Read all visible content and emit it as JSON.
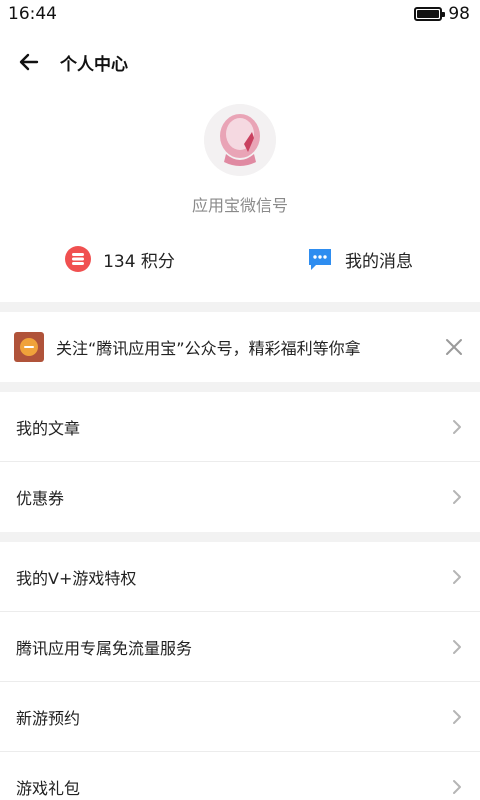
{
  "status_bar": {
    "time": "16:44",
    "battery": "98",
    "battery_level": 0.98
  },
  "header": {
    "title": "个人中心",
    "back_icon": "arrow-left-icon"
  },
  "profile": {
    "name": "应用宝微信号",
    "avatar_icon": "avatar-image"
  },
  "stats": {
    "points_label": "134 积分",
    "points_icon": "coin-stack-icon",
    "messages_label": "我的消息",
    "messages_icon": "chat-bubble-icon"
  },
  "banner": {
    "text": "关注“腾讯应用宝”公众号，精彩福利等你拿",
    "icon": "wechat-account-icon",
    "close_icon": "close-icon"
  },
  "menu_group1": [
    {
      "label": "我的文章"
    },
    {
      "label": "优惠券"
    }
  ],
  "menu_group2": [
    {
      "label": "我的V+游戏特权"
    },
    {
      "label": "腾讯应用专属免流量服务"
    },
    {
      "label": "新游预约"
    },
    {
      "label": "游戏礼包"
    }
  ],
  "colors": {
    "points_icon": "#f05050",
    "messages_icon": "#2e8df0",
    "banner_icon": "#b0533a",
    "separator": "#f2f2f2",
    "chevron": "#b5b5b5"
  }
}
